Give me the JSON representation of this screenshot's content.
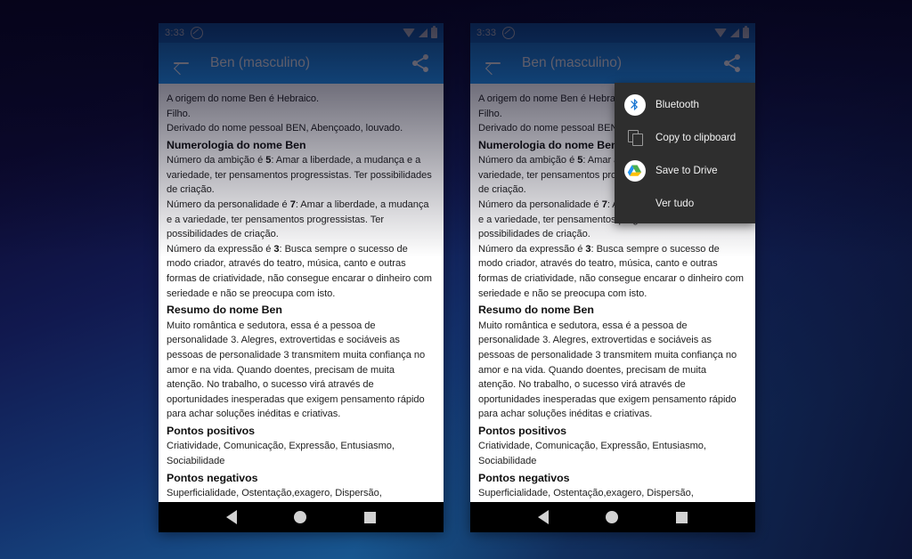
{
  "background": {
    "gradient_from": "#0a0828",
    "gradient_to": "#1b6aa4"
  },
  "theme": {
    "appbar_color": "#2196f3",
    "statusbar_color": "#1678d4",
    "menu_bg": "#2e2e2e",
    "content_bg": "#ffffff",
    "navbar_bg": "#000000"
  },
  "statusbar": {
    "clock": "3:33",
    "dnd_icon": "do-not-disturb-icon",
    "wifi_icon": "wifi-icon",
    "signal_icon": "signal-icon",
    "battery_icon": "battery-icon"
  },
  "appbar": {
    "back_icon": "back-arrow-icon",
    "title": "Ben (masculino)",
    "share_icon": "share-icon"
  },
  "content": {
    "lines": [
      {
        "style": "body",
        "text": "A origem do nome Ben é Hebraico."
      },
      {
        "style": "body",
        "text": "Filho."
      },
      {
        "style": "body",
        "text": "Derivado do nome pessoal BEN, Abençoado, louvado."
      },
      {
        "style": "heading",
        "text": "Numerologia do nome Ben"
      },
      {
        "style": "body-bold-num",
        "text": "Número da ambição é 5: Amar a liberdade, a mudança e a variedade, ter pensamentos progressistas. Ter possibilidades de criação.",
        "bold": "5"
      },
      {
        "style": "body-bold-num",
        "text": "Número da personalidade é 7: Amar a liberdade, a mudança e a variedade, ter pensamentos progressistas. Ter possibilidades de criação.",
        "bold": "7"
      },
      {
        "style": "body-bold-num",
        "text": "Número da expressão é 3: Busca sempre o sucesso de modo criador, através do teatro, música, canto e outras formas de criatividade, não consegue encarar o dinheiro com seriedade e não se preocupa com isto.",
        "bold": "3"
      },
      {
        "style": "heading",
        "text": "Resumo do nome Ben"
      },
      {
        "style": "body",
        "text": "Muito romântica e sedutora, essa é a pessoa de personalidade 3. Alegres, extrovertidas e sociáveis as pessoas de personalidade 3 transmitem muita confiança no amor e na vida. Quando doentes, precisam de muita atenção. No trabalho, o sucesso virá através de oportunidades inesperadas que exigem pensamento rápido para achar soluções inéditas e criativas."
      },
      {
        "style": "heading",
        "text": "Pontos positivos"
      },
      {
        "style": "body",
        "text": "Criatividade, Comunicação, Expressão, Entusiasmo, Sociabilidade"
      },
      {
        "style": "heading",
        "text": "Pontos negativos"
      },
      {
        "style": "body",
        "text": "Superficialidade, Ostentação,exagero, Dispersão, Imaturidade"
      }
    ]
  },
  "share_menu": {
    "items": [
      {
        "label": "Bluetooth",
        "icon": "bluetooth-icon"
      },
      {
        "label": "Copy to clipboard",
        "icon": "copy-icon"
      },
      {
        "label": "Save to Drive",
        "icon": "google-drive-icon"
      },
      {
        "label": "Ver tudo",
        "icon": "none"
      }
    ]
  },
  "navbar": {
    "back_icon": "nav-back-icon",
    "home_icon": "nav-home-icon",
    "recents_icon": "nav-recents-icon"
  }
}
